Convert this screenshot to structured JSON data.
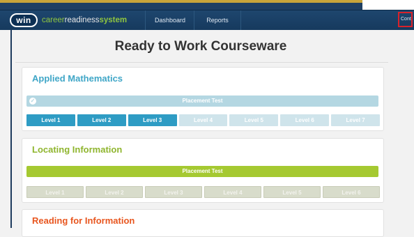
{
  "header": {
    "logo_mark": "win",
    "brand_1": "career",
    "brand_2": "readiness",
    "brand_3": "system",
    "nav": [
      "Dashboard",
      "Reports"
    ],
    "right_cut_label": "Cont"
  },
  "page": {
    "title": "Ready to Work Courseware"
  },
  "courses": [
    {
      "title": "Applied Mathematics",
      "placement_label": "Placement Test",
      "placement_completed": true,
      "levels": [
        "Level 1",
        "Level 2",
        "Level 3",
        "Level 4",
        "Level 5",
        "Level 6",
        "Level 7"
      ],
      "unlocked_levels": 3
    },
    {
      "title": "Locating Information",
      "placement_label": "Placement Test",
      "placement_completed": false,
      "levels": [
        "Level 1",
        "Level 2",
        "Level 3",
        "Level 4",
        "Level 5",
        "Level 6"
      ],
      "unlocked_levels": 0
    },
    {
      "title": "Reading for Information"
    }
  ],
  "colors": {
    "nav_bg": "#1e466e",
    "math_accent": "#3fa6c7",
    "locating_accent": "#8fb52e",
    "reading_accent": "#e8561f",
    "highlight_box": "#d9222a"
  }
}
